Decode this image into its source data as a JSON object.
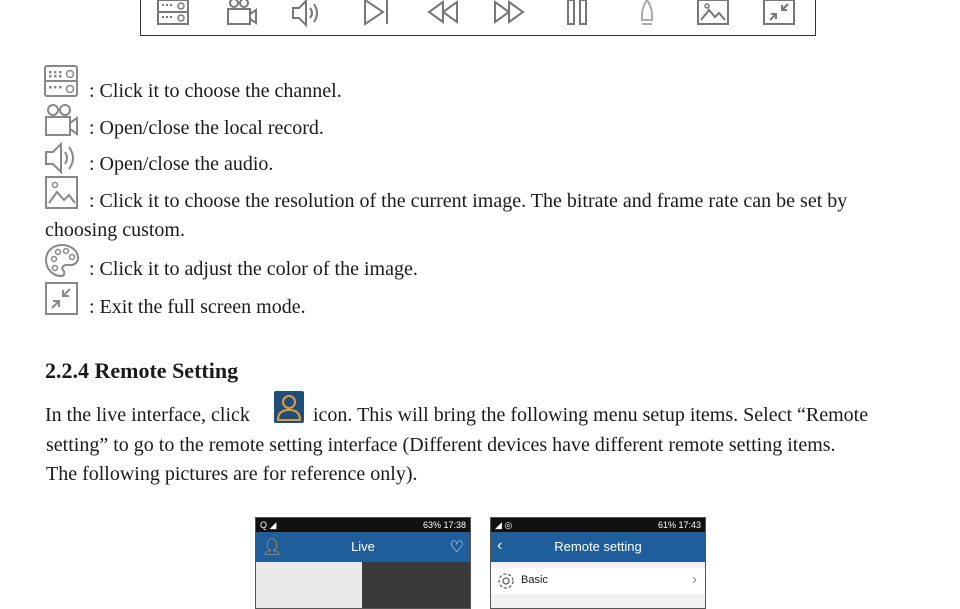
{
  "toolbar": {
    "icons": [
      "channel-grid-icon",
      "record-camera-icon",
      "audio-speaker-icon",
      "play-icon",
      "rewind-icon",
      "fast-forward-icon",
      "pause-icon",
      "rocket-icon",
      "image-resolution-icon",
      "exit-fullscreen-icon"
    ]
  },
  "items": [
    {
      "icon": "channel-grid-icon",
      "text": ": Click it to choose the channel."
    },
    {
      "icon": "record-camera-icon",
      "text": ": Open/close the local record."
    },
    {
      "icon": "audio-speaker-icon",
      "text": ": Open/close the audio."
    },
    {
      "icon": "image-resolution-icon",
      "text": ": Click it to choose the resolution of the current image. The bitrate and frame rate can be set by",
      "text2": "choosing custom."
    },
    {
      "icon": "color-palette-icon",
      "text": ": Click it to adjust the color of the image."
    },
    {
      "icon": "exit-fullscreen-icon",
      "text": ": Exit the full screen mode."
    }
  ],
  "section": {
    "heading": "2.2.4  Remote Setting",
    "line1a": "In the live interface, click",
    "line1b": "icon. This will bring the following menu setup items. Select “Remote",
    "line2": "setting” to go to the remote setting interface (Different devices have different remote setting items.",
    "line3": "The following pictures are for reference only)."
  },
  "phone_live": {
    "status_right": "63% 17:38",
    "title": "Live"
  },
  "phone_remote": {
    "status_right": "61% 17:43",
    "title": "Remote setting",
    "menu_item": "Basic"
  }
}
